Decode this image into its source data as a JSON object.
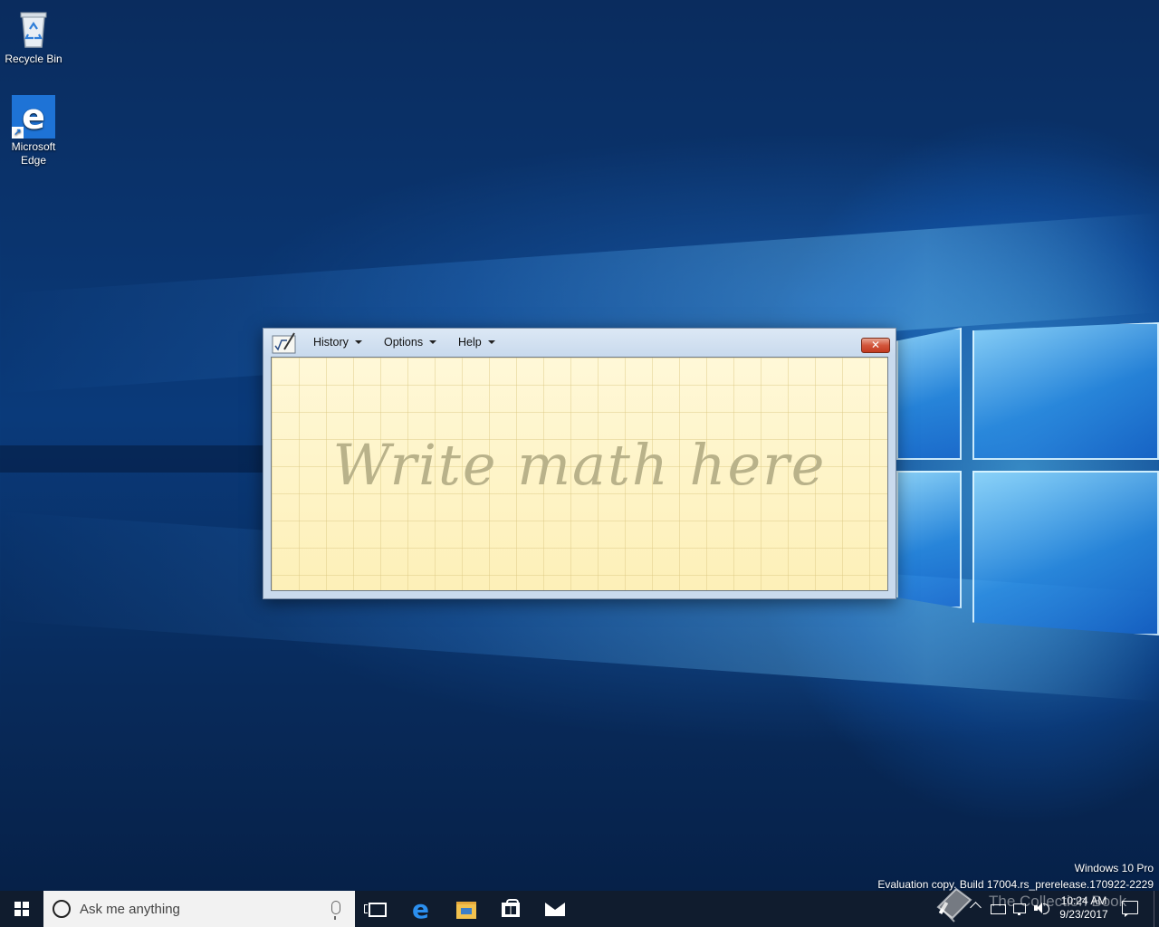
{
  "desktop": {
    "icons": [
      {
        "label": "Recycle Bin",
        "icon": "recycle-bin-icon"
      },
      {
        "label": "Microsoft\nEdge",
        "label_line1": "Microsoft",
        "label_line2": "Edge",
        "icon": "edge-icon"
      }
    ],
    "watermark": {
      "line1": "Windows 10 Pro",
      "line2": "Evaluation copy. Build 17004.rs_prerelease.170922-2229"
    }
  },
  "math_panel": {
    "menus": [
      {
        "label": "History"
      },
      {
        "label": "Options"
      },
      {
        "label": "Help"
      }
    ],
    "close_label": "✕",
    "canvas_hint": "Write math here"
  },
  "taskbar": {
    "search_placeholder": "Ask me anything",
    "pinned": [
      "task-view-icon",
      "edge-icon",
      "file-explorer-icon",
      "store-icon",
      "mail-icon"
    ],
    "clock": {
      "time": "10:24 AM",
      "date": "9/23/2017"
    },
    "overlay_brand": "The Collection Book"
  },
  "colors": {
    "taskbar": "#101c2e",
    "canvas": "#fdf3c2",
    "close": "#c23a20",
    "accent": "#2b8ff0"
  }
}
